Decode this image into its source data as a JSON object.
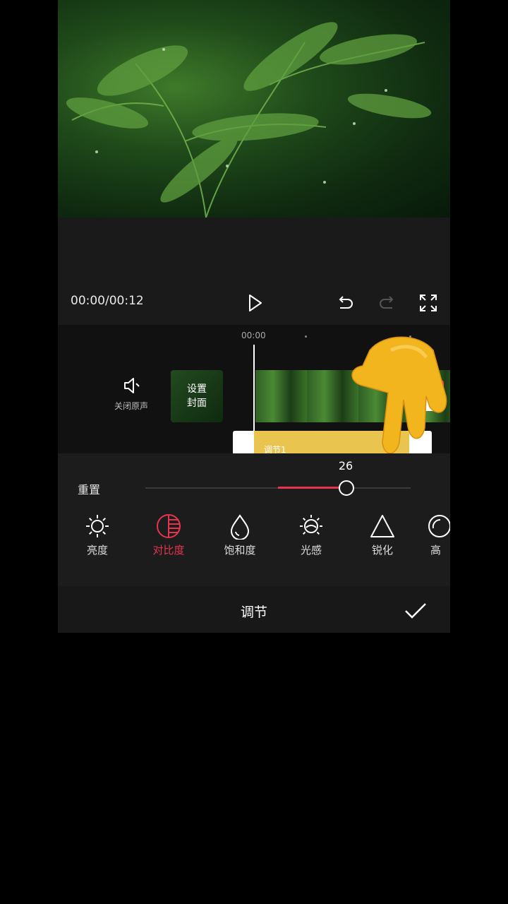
{
  "player": {
    "time": "00:00/00:12"
  },
  "timeline": {
    "ruler_time": "00:00",
    "mute_label": "关闭原声",
    "cover_label": "设置\n封面",
    "adjust_track_label": "调节1"
  },
  "adjust": {
    "reset_label": "重置",
    "value": "26",
    "slider_fraction": 0.26,
    "tools": [
      {
        "label": "亮度",
        "icon": "sun-icon"
      },
      {
        "label": "对比度",
        "icon": "contrast-icon",
        "active": true
      },
      {
        "label": "饱和度",
        "icon": "droplet-icon"
      },
      {
        "label": "光感",
        "icon": "light-sensitivity-icon"
      },
      {
        "label": "锐化",
        "icon": "triangle-icon"
      },
      {
        "label": "高",
        "icon": "highlight-icon"
      }
    ]
  },
  "footer": {
    "title": "调节"
  },
  "colors": {
    "accent": "#e6344f",
    "track_fill": "#e9c44f"
  }
}
